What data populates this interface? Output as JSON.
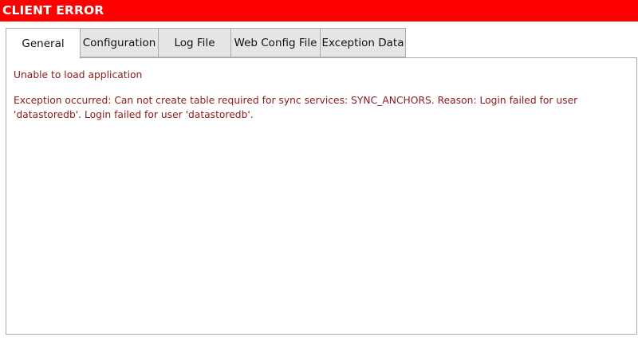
{
  "window": {
    "title": "CLIENT ERROR",
    "accent_color": "#ff0000"
  },
  "tabs": [
    {
      "label": "General",
      "active": true
    },
    {
      "label": "Configuration",
      "active": false
    },
    {
      "label": "Log File",
      "active": false
    },
    {
      "label": "Web Config File",
      "active": false
    },
    {
      "label": "Exception Data",
      "active": false
    }
  ],
  "general": {
    "heading": "Unable to load application",
    "exception": "Exception occurred: Can not create table required for sync services: SYNC_ANCHORS. Reason: Login failed for user 'datastoredb'. Login failed for user 'datastoredb'.",
    "text_color": "#8b1a1a"
  }
}
